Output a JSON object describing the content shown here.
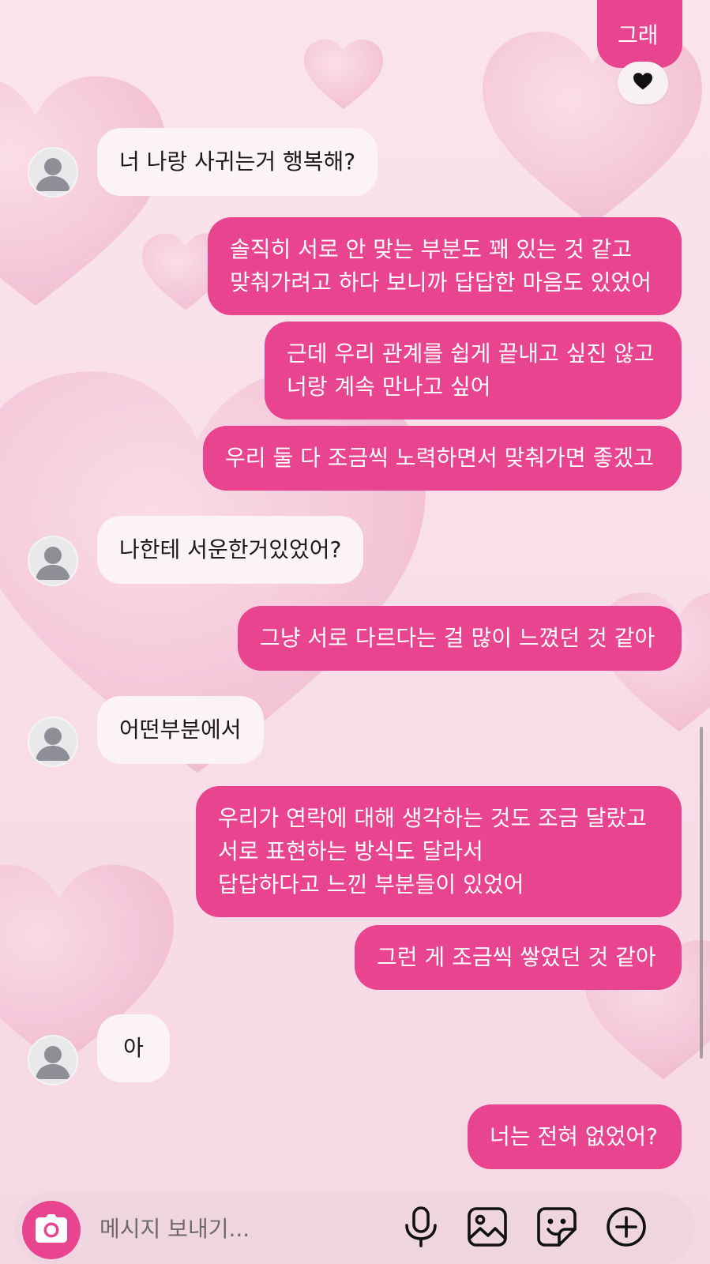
{
  "colors": {
    "outgoing_bubble": "#e8448f",
    "incoming_bubble": "#fbf3f4",
    "background": "#f7dbe7",
    "accent": "#e8448f"
  },
  "messages": [
    {
      "side": "out",
      "text": "그래",
      "reaction": "heart"
    },
    {
      "side": "in",
      "text": "너 나랑 사귀는거 행복해?"
    },
    {
      "side": "out",
      "text": "솔직히 서로 안 맞는 부분도 꽤 있는 것 같고\n맞춰가려고 하다 보니까 답답한 마음도 있었어"
    },
    {
      "side": "out",
      "text": "근데 우리 관계를 쉽게 끝내고 싶진 않고\n너랑 계속 만나고 싶어"
    },
    {
      "side": "out",
      "text": "우리 둘 다 조금씩 노력하면서 맞춰가면 좋겠고"
    },
    {
      "side": "in",
      "text": "나한테 서운한거있었어?"
    },
    {
      "side": "out",
      "text": "그냥 서로 다르다는 걸 많이 느꼈던 것 같아"
    },
    {
      "side": "in",
      "text": "어떤부분에서"
    },
    {
      "side": "out",
      "text": "우리가 연락에 대해 생각하는 것도 조금 달랐고\n서로 표현하는 방식도 달라서\n답답하다고 느낀 부분들이 있었어"
    },
    {
      "side": "out",
      "text": "그런 게 조금씩 쌓였던 것 같아"
    },
    {
      "side": "in",
      "text": "아"
    },
    {
      "side": "out",
      "text": "너는 전혀 없었어?"
    }
  ],
  "composer": {
    "placeholder": "메시지 보내기...",
    "icons": [
      "camera-icon",
      "microphone-icon",
      "image-icon",
      "sticker-icon",
      "plus-icon"
    ]
  }
}
